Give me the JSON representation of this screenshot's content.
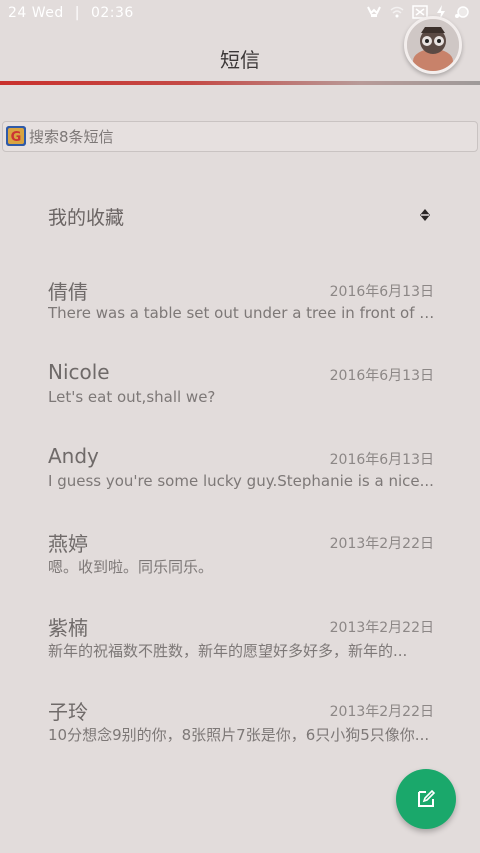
{
  "status_bar": {
    "day": "24",
    "weekday": "Wed",
    "time": "02:36"
  },
  "header": {
    "title": "短信"
  },
  "search": {
    "placeholder": "搜索8条短信"
  },
  "favorites": {
    "label": "我的收藏"
  },
  "conversations": [
    {
      "name": "倩倩",
      "date": "2016年6月13日",
      "preview": "There was a table set out under a tree in front of th..."
    },
    {
      "name": "Nicole",
      "date": "2016年6月13日",
      "preview": "Let's eat out,shall we?"
    },
    {
      "name": "Andy",
      "date": "2016年6月13日",
      "preview": "I guess you're some lucky guy.Stephanie is a nice..."
    },
    {
      "name": "燕婷",
      "date": "2013年2月22日",
      "preview": "嗯。收到啦。同乐同乐。"
    },
    {
      "name": "紫楠",
      "date": "2013年2月22日",
      "preview": "新年的祝福数不胜数，新年的愿望好多好多，新年的..."
    },
    {
      "name": "子玲",
      "date": "2013年2月22日",
      "preview": "10分想念9别的你，8张照片7张是你，6只小狗5只像你..."
    }
  ],
  "colors": {
    "accent": "#c9302c",
    "fab": "#1aa86b",
    "background": "#e2dcdb"
  },
  "icons": {
    "status": [
      "headset-icon",
      "wifi-icon",
      "notification-icon",
      "battery-charging-icon",
      "alarm-icon"
    ],
    "fab": "compose-icon",
    "favorites": "expand-icon",
    "search": "google-icon"
  }
}
